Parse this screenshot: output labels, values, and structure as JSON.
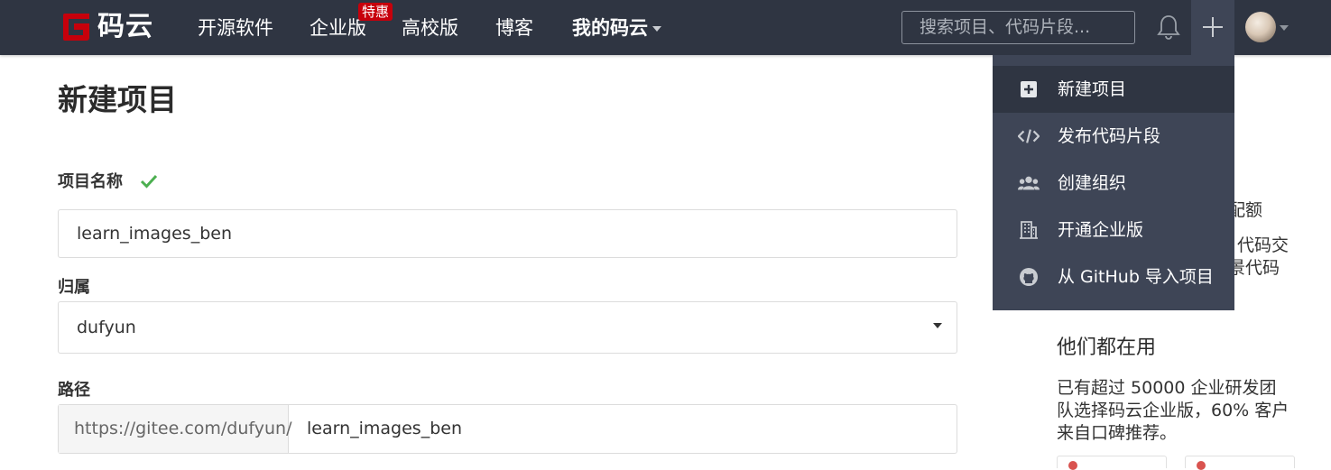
{
  "brand": {
    "logo_text": "码云",
    "logo_color": "#c7000b"
  },
  "nav": {
    "items": [
      {
        "label": "开源软件"
      },
      {
        "label": "企业版"
      },
      {
        "label": "高校版"
      },
      {
        "label": "博客"
      },
      {
        "label": "我的码云"
      }
    ],
    "badge": "特惠",
    "search_placeholder": "搜索项目、代码片段..."
  },
  "icons": {
    "notifications": "bell-icon",
    "create": "plus-icon",
    "avatar": "user-avatar"
  },
  "dropdown": {
    "items": [
      {
        "label": "新建项目",
        "icon": "plus-square-icon"
      },
      {
        "label": "发布代码片段",
        "icon": "code-icon"
      },
      {
        "label": "创建组织",
        "icon": "users-icon"
      },
      {
        "label": "开通企业版",
        "icon": "building-icon"
      },
      {
        "label": "从 GitHub 导入项目",
        "icon": "github-icon"
      }
    ]
  },
  "form": {
    "title": "新建项目",
    "name_label": "项目名称",
    "name_value": "learn_images_ben",
    "owner_label": "归属",
    "owner_value": "dufyun",
    "path_label": "路径",
    "path_prefix": "https://gitee.com/dufyun/",
    "path_value": "learn_images_ben"
  },
  "sidebar": {
    "partial_line_1": "配额",
    "partial_line_2": "代码交",
    "partial_line_3": "景代码",
    "heading": "他们都在用",
    "paragraph": "已有超过 50000 企业研发团队选择码云企业版，60% 客户来自口碑推荐。"
  },
  "colors": {
    "nav_bg": "#2f3542",
    "dropdown_bg": "#3e4556",
    "badge": "#c7000b",
    "check": "#4caf50"
  }
}
